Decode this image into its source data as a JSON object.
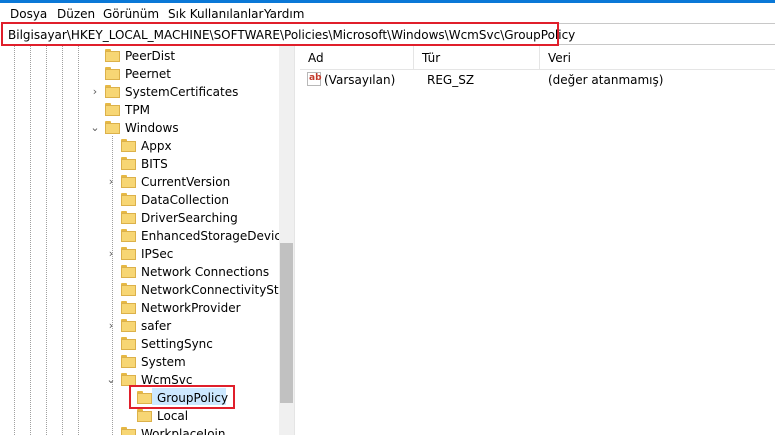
{
  "menu": [
    "Dosya",
    "Düzen",
    "Görünüm",
    "Sık Kullanılanlar",
    "Yardım"
  ],
  "address": "Bilgisayar\\HKEY_LOCAL_MACHINE\\SOFTWARE\\Policies\\Microsoft\\Windows\\WcmSvc\\GroupPolicy",
  "tree": [
    {
      "label": "PeerDist",
      "expander": ""
    },
    {
      "label": "Peernet",
      "expander": ""
    },
    {
      "label": "SystemCertificates",
      "expander": "›"
    },
    {
      "label": "TPM",
      "expander": ""
    },
    {
      "label": "Windows",
      "expander": "⌄"
    },
    {
      "label": "Appx",
      "expander": ""
    },
    {
      "label": "BITS",
      "expander": ""
    },
    {
      "label": "CurrentVersion",
      "expander": "›"
    },
    {
      "label": "DataCollection",
      "expander": ""
    },
    {
      "label": "DriverSearching",
      "expander": ""
    },
    {
      "label": "EnhancedStorageDevices",
      "expander": ""
    },
    {
      "label": "IPSec",
      "expander": "›"
    },
    {
      "label": "Network Connections",
      "expander": ""
    },
    {
      "label": "NetworkConnectivityStatu",
      "expander": ""
    },
    {
      "label": "NetworkProvider",
      "expander": ""
    },
    {
      "label": "safer",
      "expander": "›"
    },
    {
      "label": "SettingSync",
      "expander": ""
    },
    {
      "label": "System",
      "expander": ""
    },
    {
      "label": "WcmSvc",
      "expander": "⌄"
    },
    {
      "label": "GroupPolicy",
      "expander": ""
    },
    {
      "label": "Local",
      "expander": ""
    },
    {
      "label": "WorkplaceJoin",
      "expander": ""
    }
  ],
  "columns": {
    "name": "Ad",
    "type": "Tür",
    "data": "Veri"
  },
  "values": [
    {
      "name": "(Varsayılan)",
      "type": "REG_SZ",
      "data": "(değer atanmamış)",
      "icon": "ab"
    }
  ]
}
